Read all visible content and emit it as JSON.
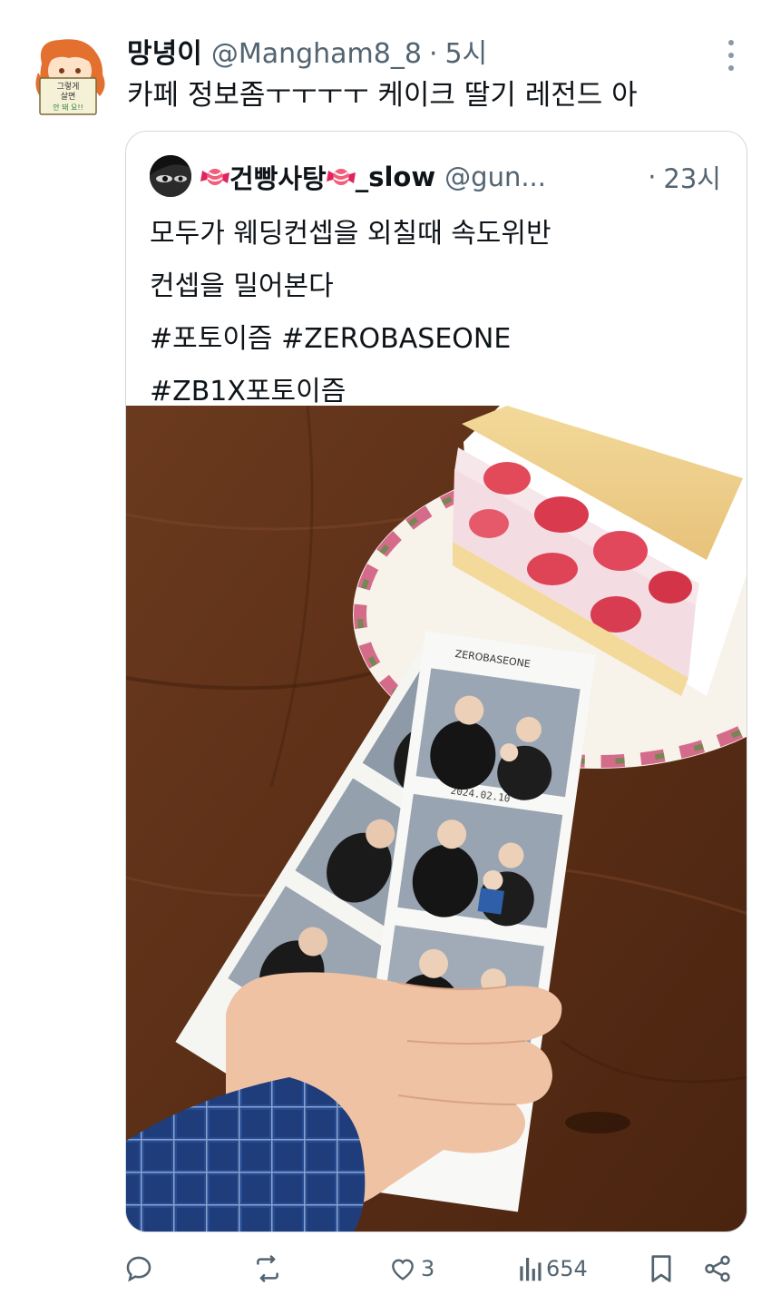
{
  "tweet": {
    "display_name": "망녕이",
    "handle": "@Mangham8_8",
    "separator": "·",
    "time": "5시",
    "text": "카페 정보좀ㅜㅜㅜㅜ 케이크 딸기 레전드 아",
    "avatar": {
      "sign_line1": "그렇게",
      "sign_line2": "살면",
      "sign_line3": "안 돼 요!!"
    }
  },
  "quote": {
    "display_name": "건빵사탕",
    "name_suffix": "_slow",
    "handle": "@gun...",
    "separator": "·",
    "time": "23시",
    "text_lines": [
      "모두가 웨딩컨셉을 외칠때 속도위반",
      "컨셉을 밀어본다",
      "#포토이즘 #ZEROBASEONE",
      "#ZB1X포토이즘"
    ],
    "photo": {
      "strip_date": "2024.02.10",
      "strip_brand": "ZEROBASEONE"
    }
  },
  "actions": {
    "reply_count": "",
    "retweet_count": "",
    "like_count": "3",
    "view_count": "654"
  },
  "colors": {
    "text_primary": "#0f1419",
    "text_secondary": "#536471",
    "border": "#cfd9de",
    "hashtag": "#0f1419"
  }
}
